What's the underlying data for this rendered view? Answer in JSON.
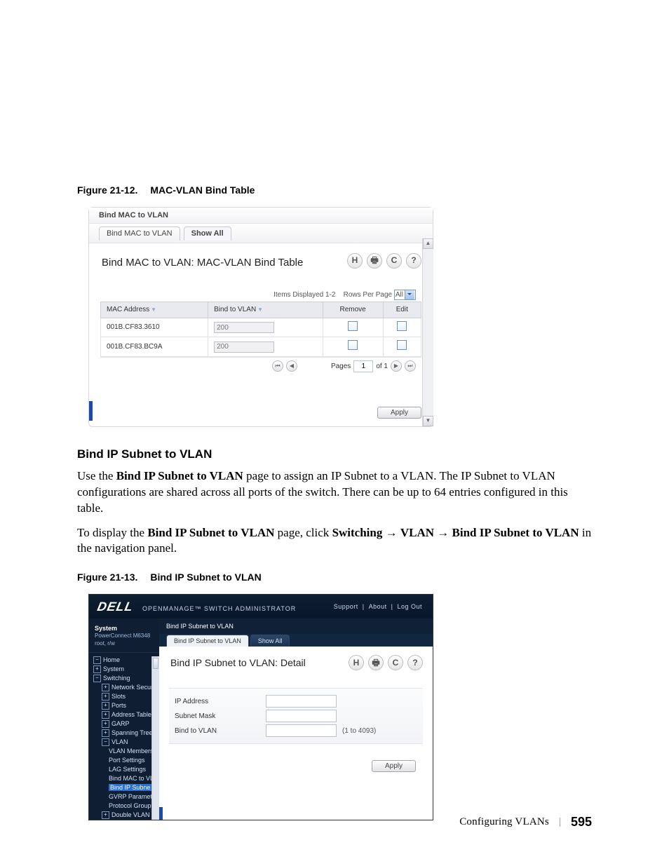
{
  "captions": {
    "fig1_num": "Figure 21-12.",
    "fig1_title": "MAC-VLAN Bind Table",
    "fig2_num": "Figure 21-13.",
    "fig2_title": "Bind IP Subnet to VLAN"
  },
  "section_heading": "Bind IP Subnet to VLAN",
  "body": {
    "p1a": "Use the ",
    "p1_bold": "Bind IP Subnet to VLAN",
    "p1b": " page to assign an IP Subnet to a VLAN. The IP Subnet to VLAN configurations are shared across all ports of the switch. There can be up to 64 entries configured in this table.",
    "p2a": "To display the ",
    "p2_bold1": "Bind IP Subnet to VLAN",
    "p2b": " page, click ",
    "p2_bold2": "Switching",
    "p2_arrow1": " → ",
    "p2_bold3": "VLAN",
    "p2_arrow2": " → ",
    "p2_bold4": "Bind IP Subnet to VLAN",
    "p2c": " in the navigation panel."
  },
  "fig1": {
    "window_title": "Bind MAC to VLAN",
    "tab1": "Bind MAC to VLAN",
    "tab2": "Show All",
    "page_title": "Bind MAC to VLAN: MAC-VLAN Bind Table",
    "icons": {
      "save": "H",
      "print": "🖶",
      "refresh": "C",
      "help": "?"
    },
    "items_displayed_label": "Items Displayed 1-2",
    "rows_per_page_label": "Rows Per Page",
    "rows_per_page_value": "All",
    "cols": {
      "mac": "MAC Address",
      "bind": "Bind to VLAN",
      "remove": "Remove",
      "edit": "Edit"
    },
    "rows": [
      {
        "mac": "001B.CF83.3610",
        "vlan": "200"
      },
      {
        "mac": "001B.CF83.BC9A",
        "vlan": "200"
      }
    ],
    "pages_label": "Pages",
    "page_value": "1",
    "of_label": "of 1",
    "apply": "Apply"
  },
  "fig2": {
    "brand": "DELL",
    "subbrand": "OPENMANAGE™ SWITCH ADMINISTRATOR",
    "toplinks": {
      "support": "Support",
      "about": "About",
      "logout": "Log Out"
    },
    "side": {
      "system": "System",
      "model": "PowerConnect M6348",
      "user": "root, r/w",
      "tree": {
        "home": "Home",
        "system": "System",
        "switching": "Switching",
        "network_security": "Network Security",
        "slots": "Slots",
        "ports": "Ports",
        "address_tables": "Address Tables",
        "garp": "GARP",
        "spanning_tree": "Spanning Tree",
        "vlan": "VLAN",
        "vlan_membership": "VLAN Membersh",
        "port_settings": "Port Settings",
        "lag_settings": "LAG Settings",
        "bind_mac": "Bind MAC to VLA",
        "bind_ip": "Bind IP Subne",
        "gvrp": "GVRP Paramete",
        "protocol_group": "Protocol Group",
        "double_vlan": "Double VLAN"
      }
    },
    "crumb": "Bind IP Subnet to VLAN",
    "tab1": "Bind IP Subnet to VLAN",
    "tab2": "Show All",
    "page_title": "Bind IP Subnet to VLAN: Detail",
    "icons": {
      "save": "H",
      "print": "🖶",
      "refresh": "C",
      "help": "?"
    },
    "form": {
      "ip": "IP Address",
      "mask": "Subnet Mask",
      "bind": "Bind to VLAN",
      "hint": "(1 to 4093)"
    },
    "apply": "Apply"
  },
  "footer": {
    "chapter": "Configuring VLANs",
    "page": "595"
  }
}
